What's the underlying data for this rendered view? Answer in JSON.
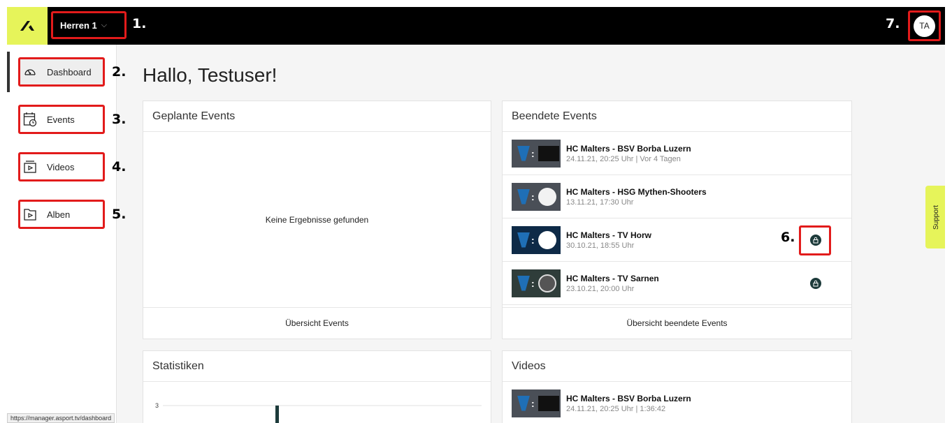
{
  "topbar": {
    "team_label": "Herren 1",
    "team_chevron": "⌵",
    "avatar_initials": "TA",
    "annotation_team": "1.",
    "annotation_avatar": "7."
  },
  "sidebar": {
    "items": [
      {
        "label": "Dashboard",
        "icon": "gauge-icon",
        "annotation": "2."
      },
      {
        "label": "Events",
        "icon": "calendar-clock-icon",
        "annotation": "3."
      },
      {
        "label": "Videos",
        "icon": "video-play-icon",
        "annotation": "4."
      },
      {
        "label": "Alben",
        "icon": "folder-play-icon",
        "annotation": "5."
      }
    ],
    "status_url": "https://manager.asport.tv/dashboard"
  },
  "main": {
    "greeting": "Hallo, Testuser!",
    "planned_events": {
      "title": "Geplante Events",
      "empty_text": "Keine Ergebnisse gefunden",
      "footer_link": "Übersicht Events"
    },
    "finished_events": {
      "title": "Beendete Events",
      "items": [
        {
          "title": "HC Malters - BSV Borba Luzern",
          "subtitle": "24.11.21, 20:25 Uhr | Vor 4 Tagen",
          "locked": false
        },
        {
          "title": "HC Malters - HSG Mythen-Shooters",
          "subtitle": "13.11.21, 17:30 Uhr",
          "locked": false
        },
        {
          "title": "HC Malters - TV Horw",
          "subtitle": "30.10.21, 18:55 Uhr",
          "locked": true,
          "annotation": "6."
        },
        {
          "title": "HC Malters - TV Sarnen",
          "subtitle": "23.10.21, 20:00 Uhr",
          "locked": true
        }
      ],
      "footer_link": "Übersicht beendete Events"
    },
    "statistics": {
      "title": "Statistiken",
      "y_tick_top": "3"
    },
    "videos": {
      "title": "Videos",
      "items": [
        {
          "title": "HC Malters - BSV Borba Luzern",
          "subtitle": "24.11.21, 20:25 Uhr | 1:36:42"
        }
      ]
    }
  },
  "support_label": "Support",
  "colors": {
    "accent": "#e6f45a",
    "topbar": "#000000",
    "annotation_box": "#e21b1b",
    "lock": "#1d3b3b"
  }
}
